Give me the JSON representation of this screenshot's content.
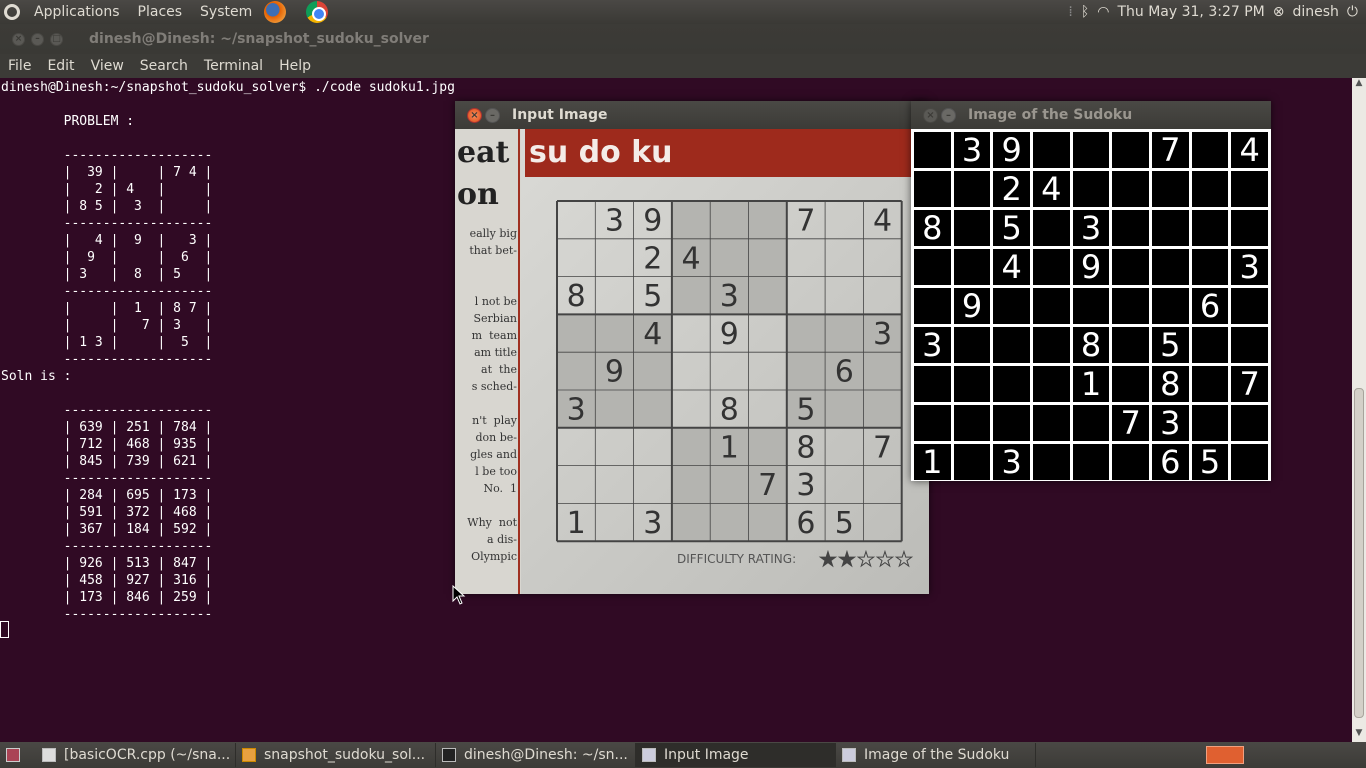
{
  "top_panel": {
    "menus": [
      "Applications",
      "Places",
      "System"
    ],
    "datetime": "Thu May 31,  3:27 PM",
    "user": "dinesh"
  },
  "terminal": {
    "title": "dinesh@Dinesh: ~/snapshot_sudoku_solver",
    "menu": [
      "File",
      "Edit",
      "View",
      "Search",
      "Terminal",
      "Help"
    ],
    "output": "dinesh@Dinesh:~/snapshot_sudoku_solver$ ./code sudoku1.jpg\n\n        PROBLEM :\n\n        -------------------\n        |  39 |     | 7 4 |\n        |   2 | 4   |     |\n        | 8 5 |  3  |     |\n        -------------------\n        |   4 |  9  |   3 |\n        |  9  |     |  6  |\n        | 3   |  8  | 5   |\n        -------------------\n        |     |  1  | 8 7 |\n        |     |   7 | 3   |\n        | 1 3 |     |  5  |\n        -------------------\nSoln is :\n\n        -------------------\n        | 639 | 251 | 784 |\n        | 712 | 468 | 935 |\n        | 845 | 739 | 621 |\n        -------------------\n        | 284 | 695 | 173 |\n        | 591 | 372 | 468 |\n        | 367 | 184 | 592 |\n        -------------------\n        | 926 | 513 | 847 |\n        | 458 | 927 | 316 |\n        | 173 | 846 | 259 |\n        -------------------\n"
  },
  "input_window": {
    "title": "Input Image",
    "paper": {
      "masthead_left": "eat",
      "masthead_left2": "on",
      "logo": "su do ku",
      "side_text": "eally big\n that bet-\n\n\n l not be\n Serbian\n m  team\n am title\n at  the\n s sched-\n\nn't  play\n don be-\ngles and\n l be too\n No.  1\n\nWhy  not\n a dis-\nOlympic",
      "difficulty": "DIFFICULTY RATING:",
      "stars_filled": 2,
      "stars_total": 5
    }
  },
  "sudoku_window": {
    "title": "Image of the Sudoku",
    "grid": [
      [
        "",
        "3",
        "9",
        "",
        "",
        "",
        "7",
        "",
        "4"
      ],
      [
        "",
        "",
        "2",
        "4",
        "",
        "",
        "",
        "",
        ""
      ],
      [
        "8",
        "",
        "5",
        "",
        "3",
        "",
        "",
        "",
        ""
      ],
      [
        "",
        "",
        "4",
        "",
        "9",
        "",
        "",
        "",
        "3"
      ],
      [
        "",
        "9",
        "",
        "",
        "",
        "",
        "",
        "6",
        ""
      ],
      [
        "3",
        "",
        "",
        "",
        "8",
        "",
        "5",
        "",
        ""
      ],
      [
        "",
        "",
        "",
        "",
        "1",
        "",
        "8",
        "",
        "7"
      ],
      [
        "",
        "",
        "",
        "",
        "",
        "7",
        "3",
        "",
        ""
      ],
      [
        "1",
        "",
        "3",
        "",
        "",
        "",
        "6",
        "5",
        ""
      ]
    ]
  },
  "taskbar": {
    "items": [
      "[basicOCR.cpp (~/sna...",
      "snapshot_sudoku_sol...",
      "dinesh@Dinesh: ~/sn...",
      "Input Image",
      "Image of the Sudoku"
    ]
  }
}
